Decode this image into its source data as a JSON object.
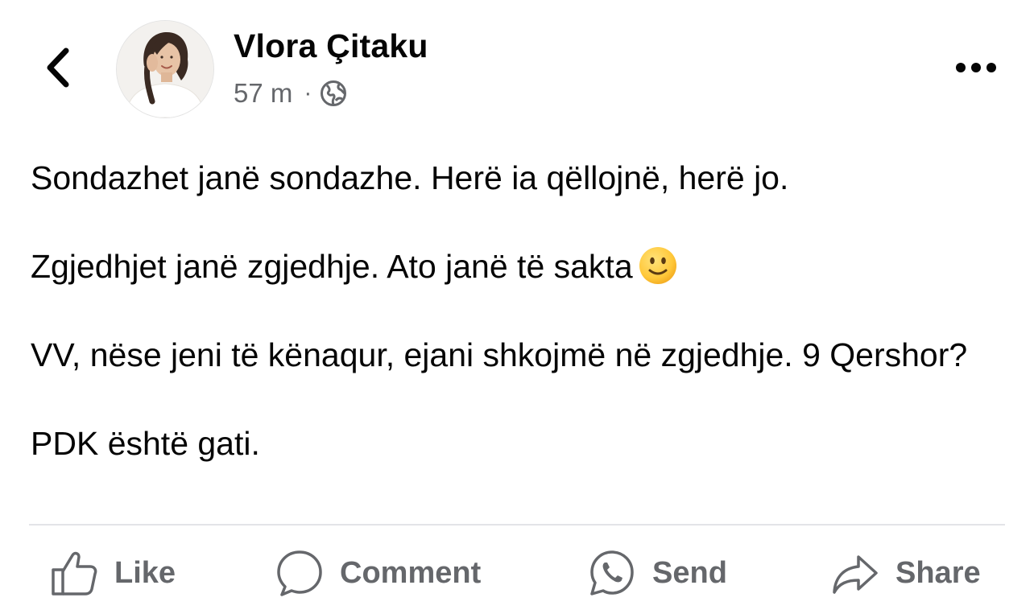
{
  "post": {
    "author": "Vlora Çitaku",
    "time": "57 m",
    "separator": "·",
    "privacy_icon": "globe-icon",
    "paragraphs": {
      "p1": "Sondazhet janë sondazhe. Herë ia qëllojnë, herë jo.",
      "p2": "Zgjedhjet janë zgjedhje. Ato janë të sakta",
      "p3": "VV, nëse jeni të kënaqur, ejani shkojmë në zgjedhje.  9 Qershor?",
      "p4": "PDK është gati."
    },
    "p2_emoji": "slightly-smiling-face"
  },
  "actions": {
    "like": "Like",
    "comment": "Comment",
    "send": "Send",
    "share": "Share"
  },
  "colors": {
    "text": "#050505",
    "secondary": "#65676b",
    "divider": "#e3e4e8",
    "emoji_fill": "#ffcc33"
  }
}
